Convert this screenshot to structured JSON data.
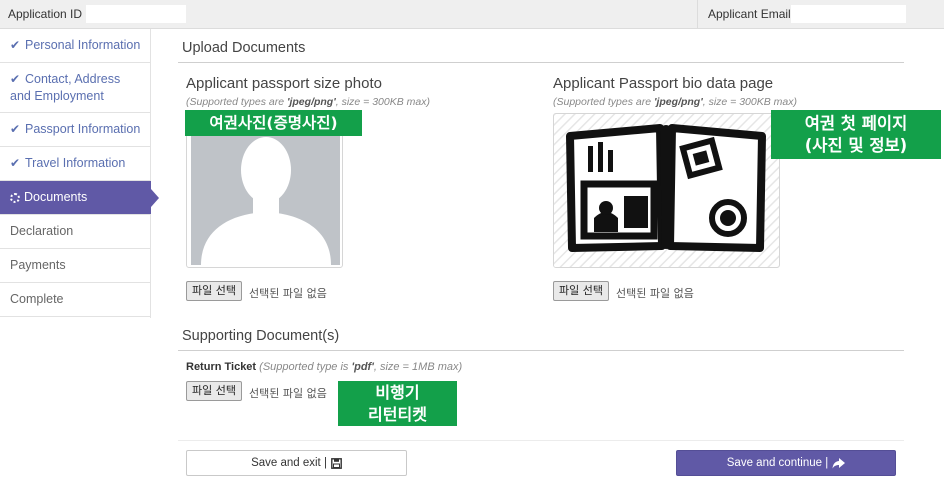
{
  "header": {
    "application_id_label": "Application ID :",
    "applicant_email_label": "Applicant Email :"
  },
  "sidebar": {
    "items": [
      {
        "label": "Personal Information",
        "state": "done"
      },
      {
        "label": "Contact, Address and Employment",
        "state": "done"
      },
      {
        "label": "Passport Information",
        "state": "done"
      },
      {
        "label": "Travel Information",
        "state": "done"
      },
      {
        "label": "Documents",
        "state": "active"
      },
      {
        "label": "Declaration",
        "state": "pending"
      },
      {
        "label": "Payments",
        "state": "pending"
      },
      {
        "label": "Complete",
        "state": "pending"
      }
    ]
  },
  "upload": {
    "section_title": "Upload Documents",
    "photo": {
      "title": "Applicant passport size photo",
      "supported_prefix": "(Supported types are ",
      "supported_types": "'jpeg/png'",
      "supported_suffix": ", size = 300KB max)",
      "choose_label": "파일 선택",
      "status": "선택된 파일 없음"
    },
    "bio_page": {
      "title": "Applicant Passport bio data page",
      "supported_prefix": "(Supported types are ",
      "supported_types": "'jpeg/png'",
      "supported_suffix": ", size = 300KB max)",
      "choose_label": "파일 선택",
      "status": "선택된 파일 없음"
    }
  },
  "supporting": {
    "section_title": "Supporting Document(s)",
    "ticket": {
      "name": "Return Ticket",
      "supported_prefix": " (Supported type is ",
      "supported_types": "'pdf'",
      "supported_suffix": ", size = 1MB max)",
      "choose_label": "파일 선택",
      "status": "선택된 파일 없음"
    }
  },
  "annotations": {
    "photo_note": "여권사진(증명사진)",
    "bio_note": "여권 첫 페이지\n(사진 및 정보)",
    "ticket_note": "비행기\n리턴티켓"
  },
  "actions": {
    "save_exit_label": "Save and exit |",
    "save_continue_label": "Save and continue |"
  },
  "icons": {
    "check": "check-icon",
    "spinner": "spinner-icon",
    "save": "floppy-disk-icon",
    "continue": "share-arrow-icon"
  },
  "colors": {
    "accent": "#6059a6",
    "annotation_green": "#13a04a",
    "completed_link": "#5a6fb0"
  }
}
